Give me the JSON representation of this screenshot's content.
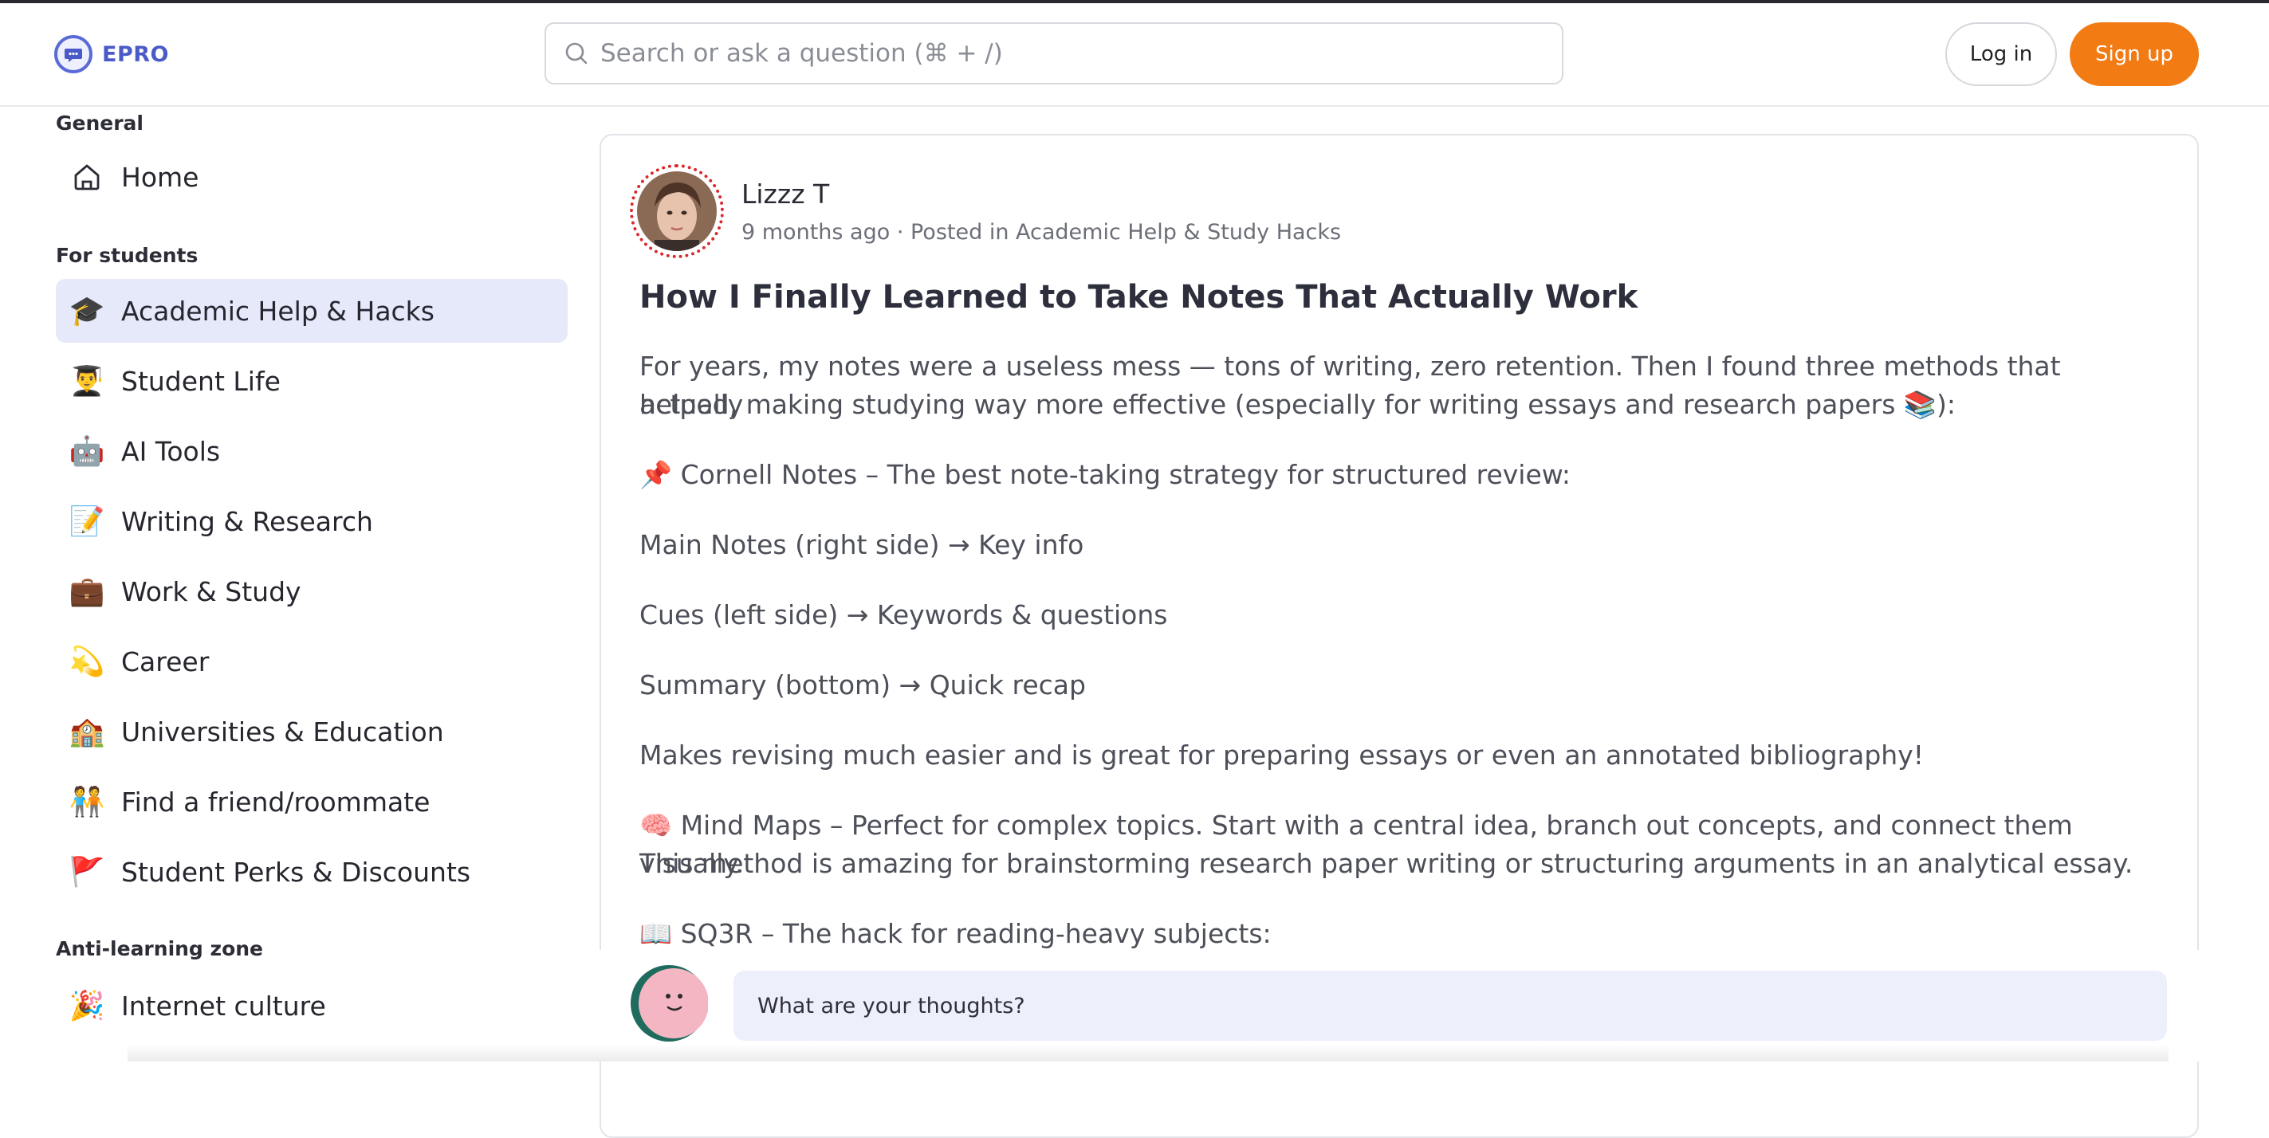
{
  "brand": {
    "name": "EPRO",
    "accent": "#4a5bc7"
  },
  "search": {
    "placeholder": "Search or ask a question (⌘ + /)"
  },
  "auth": {
    "login_label": "Log in",
    "signup_label": "Sign up",
    "signup_color": "#f27b13"
  },
  "sidebar": {
    "general_title": "General",
    "home_label": "Home",
    "students_title": "For students",
    "items": [
      {
        "label": "Academic Help & Hacks",
        "icon": "🎓",
        "active": true
      },
      {
        "label": "Student Life",
        "icon": "👨‍🎓"
      },
      {
        "label": "AI Tools",
        "icon": "🤖"
      },
      {
        "label": "Writing & Research",
        "icon": "📝"
      },
      {
        "label": "Work & Study",
        "icon": "💼"
      },
      {
        "label": "Career",
        "icon": "💫"
      },
      {
        "label": "Universities & Education",
        "icon": "🏫"
      },
      {
        "label": "Find a friend/roommate",
        "icon": "🧑‍🤝‍🧑"
      },
      {
        "label": "Student Perks & Discounts",
        "icon": "🚩"
      }
    ],
    "anti_title": "Anti-learning zone",
    "anti_items": [
      {
        "label": "Internet culture",
        "icon": "🎉"
      }
    ]
  },
  "post": {
    "author": "Lizzz T",
    "meta": "9 months ago · Posted in Academic Help & Study Hacks",
    "title": "How I Finally Learned to Take Notes That Actually Work",
    "intro_line1": "For years, my notes were a useless mess — tons of writing, zero retention. Then I found three methods that actually",
    "intro_line2": "helped, making studying way more effective (especially for writing essays and research papers 📚):",
    "cornell": "📌 Cornell Notes – The best note-taking strategy for structured review:",
    "main_notes": "Main Notes (right side) → Key info",
    "cues": "Cues (left side) → Keywords & questions",
    "summary": "Summary (bottom) → Quick recap",
    "makes": "Makes revising much easier and is great for preparing essays or even an annotated bibliography!",
    "mindmaps_line1": "🧠 Mind Maps – Perfect for complex topics. Start with a central idea, branch out concepts, and connect them visually.",
    "mindmaps_line2": "This method is amazing for brainstorming research paper writing or structuring arguments in an analytical essay.",
    "sq3r": "📖 SQ3R – The hack for reading-heavy subjects:"
  },
  "comment": {
    "placeholder": "What are your thoughts?"
  }
}
